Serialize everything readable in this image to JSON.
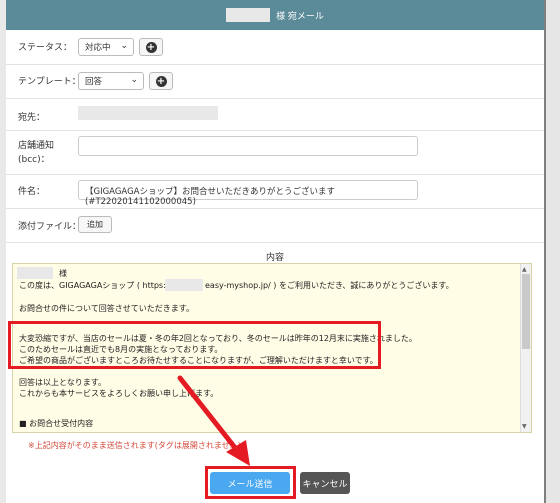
{
  "header": {
    "title_suffix": "様 宛メール"
  },
  "form": {
    "status": {
      "label": "ステータス：",
      "value": "対応中"
    },
    "template": {
      "label": "テンプレート：",
      "value": "回答"
    },
    "recipient": {
      "label": "宛先："
    },
    "store_notice": {
      "label_line1": "店舗通知",
      "label_line2": "(bcc)："
    },
    "subject": {
      "label": "件名：",
      "value": "【GIGAGAGAショップ】お問合せいただきありがとうございます (#T22020141102000045)"
    },
    "attachment": {
      "label": "添付ファイル：",
      "button": "追加"
    }
  },
  "content": {
    "title": "内容",
    "lines": [
      "様",
      "この度は、GIGAGAGAショップ ( https://",
      "easy-myshop.jp/ ) をご利用いただき、誠にありがとうございます。",
      "お問合せの件について回答させていただきます。",
      "大変恐縮ですが、当店のセールは夏・冬の年2回となっており、冬のセールは昨年の12月末に実施されました。",
      "このためセールは直近でも8月の実施となっております。",
      "ご希望の商品がございますところお待たせすることになりますが、ご理解いただけますと幸いです。",
      "回答は以上となります。",
      "これからも本サービスをよろしくお願い申し上げます。",
      "■ お問合せ受付内容"
    ]
  },
  "notice": "※上記内容がそのまま送信されます(タグは展開されません)",
  "buttons": {
    "send": "メール送信",
    "cancel": "キャンセル"
  },
  "colors": {
    "header": "#5b8a99",
    "send": "#4aa8f0",
    "highlight": "#e41b23",
    "notice": "#d24a3a"
  }
}
